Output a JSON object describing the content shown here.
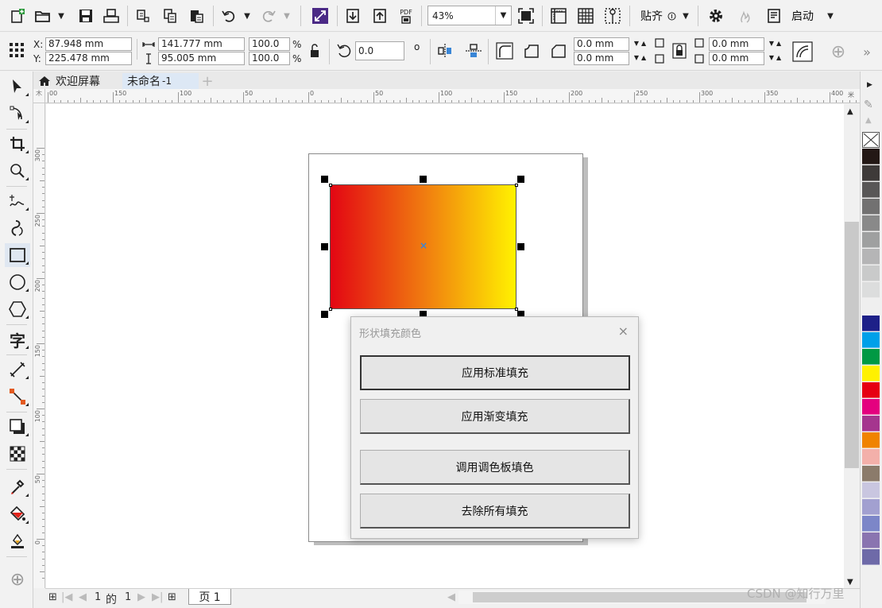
{
  "toolbar": {
    "zoom_value": "43%",
    "snap_label": "贴齐",
    "launch_label": "启动",
    "pdf_label": "PDF"
  },
  "propertybar": {
    "x_label": "X:",
    "y_label": "Y:",
    "x_value": "87.948 mm",
    "y_value": "225.478 mm",
    "width_value": "141.777 mm",
    "height_value": "95.005 mm",
    "scale_w": "100.0",
    "scale_h": "100.0",
    "percent": "%",
    "rotation": "0.0",
    "degree": "o",
    "corner_r1": "0.0 mm",
    "corner_r2": "0.0 mm",
    "corner_r3": "0.0 mm",
    "corner_r4": "0.0 mm"
  },
  "tabs": {
    "welcome": "欢迎屏幕",
    "document": "未命名",
    "document_suffix": "-1"
  },
  "ruler": {
    "h_labels": [
      "00",
      "150",
      "100",
      "50",
      "0",
      "50",
      "100",
      "150",
      "200",
      "250",
      "300",
      "350",
      "400"
    ],
    "v_labels": [
      "300",
      "250",
      "200",
      "150",
      "100",
      "50",
      "0"
    ],
    "unit_icon": "米",
    "corner_icon": "木"
  },
  "dialog": {
    "title": "形状填充颜色",
    "close": "×",
    "btn_standard": "应用标准填充",
    "btn_gradient": "应用渐变填充",
    "btn_palette": "调用调色板填色",
    "btn_remove": "去除所有填充"
  },
  "bottombar": {
    "page_current": "1",
    "page_of": "的",
    "page_total": "1",
    "page_tab": "页 1"
  },
  "palette": {
    "colors": [
      "#231815",
      "#3e3a39",
      "#595757",
      "#727171",
      "#898989",
      "#9fa0a0",
      "#b5b5b6",
      "#c9caca",
      "#dcdddd",
      "#efefef",
      "#1d2088",
      "#00a0e9",
      "#009944",
      "#fff100",
      "#e60012",
      "#e4007f",
      "#a5358e",
      "#f08300",
      "#f3b0aa",
      "#8b7b6b",
      "#c9c6e0",
      "#a2a0d0",
      "#7c86c8",
      "#8a74b0",
      "#6e6aa8"
    ]
  },
  "shape": {
    "gradient_start": "#e30613",
    "gradient_mid": "#f07a10",
    "gradient_end": "#fff200"
  },
  "watermark": "CSDN @知行万里"
}
